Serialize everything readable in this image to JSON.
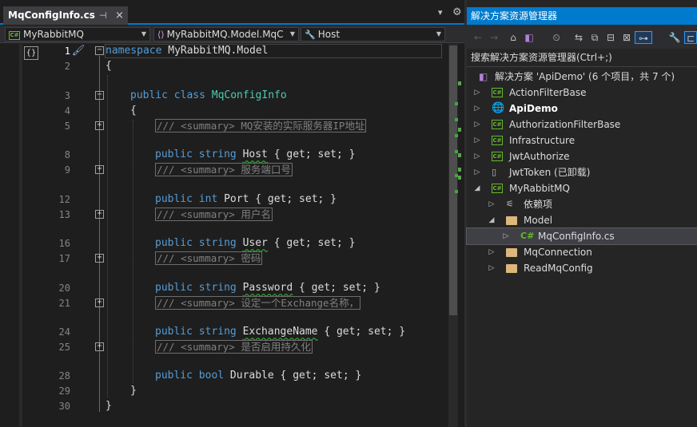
{
  "editor": {
    "tab_title": "MqConfigInfo.cs",
    "tab_pin": "⊣",
    "tab_close": "×",
    "overflow": "▾",
    "gear": "⚙",
    "nav_project": "MyRabbitMQ",
    "nav_class": "MyRabbitMQ.Model.MqC",
    "nav_member": "Host",
    "codelens": "{}",
    "lightbulb": "🖌",
    "line_numbers": [
      "1",
      "2",
      "3",
      "4",
      "5",
      "8",
      "9",
      "12",
      "13",
      "16",
      "17",
      "20",
      "21",
      "24",
      "25",
      "28",
      "29",
      "30"
    ],
    "code": {
      "l1_kw": "namespace",
      "l1_name": " MyRabbitMQ.Model",
      "l2": "{",
      "l3_kw": "public class",
      "l3_type": "MqConfigInfo",
      "l4": "{",
      "l5_comment": "/// <summary> MQ安装的实际服务器IP地址",
      "l8_kw": "public string",
      "l8_name": "Host",
      "l8_acc": "{ get; set; }",
      "l9_comment": "/// <summary> 服务端口号",
      "l12_kw": "public int",
      "l12_name": "Port",
      "l12_acc": "{ get; set; }",
      "l13_comment": "/// <summary> 用户名",
      "l16_kw": "public string",
      "l16_name": "User",
      "l16_acc": "{ get; set; }",
      "l17_comment": "/// <summary> 密码",
      "l20_kw": "public string",
      "l20_name": "Password",
      "l20_acc": "{ get; set; }",
      "l21_comment": "/// <summary> 设定一个Exchange名称，",
      "l24_kw": "public string",
      "l24_name": "ExchangeName",
      "l24_acc": "{ get; set; }",
      "l25_comment": "/// <summary> 是否启用持久化",
      "l28_kw": "public bool",
      "l28_name": "Durable",
      "l28_acc": "{ get; set; }",
      "l29": "}",
      "l30": "}"
    }
  },
  "solution_explorer": {
    "title": "解决方案资源管理器",
    "search_placeholder": "搜索解决方案资源管理器(Ctrl+;)",
    "solution_label": "解决方案 'ApiDemo' (6 个项目，共 7 个)",
    "items": [
      {
        "label": "ActionFilterBase"
      },
      {
        "label": "ApiDemo"
      },
      {
        "label": "AuthorizationFilterBase"
      },
      {
        "label": "Infrastructure"
      },
      {
        "label": "JwtAuthorize"
      },
      {
        "label": "JwtToken (已卸载)"
      },
      {
        "label": "MyRabbitMQ"
      },
      {
        "label": "依赖项"
      },
      {
        "label": "Model"
      },
      {
        "label": "MqConfigInfo.cs"
      },
      {
        "label": "MqConnection"
      },
      {
        "label": "ReadMqConfig"
      }
    ]
  },
  "icons": {
    "back": "←",
    "forward": "→",
    "home": "⌂",
    "vs": "◧",
    "history": "⏲",
    "sync": "⇆",
    "pages": "⧉",
    "collapse": "⊟",
    "preview": "⊠",
    "tree": "⊶",
    "wrench": "🔧",
    "props": "⊏",
    "expand_closed": "▷",
    "expand_open": "◢",
    "cs": "C#"
  }
}
